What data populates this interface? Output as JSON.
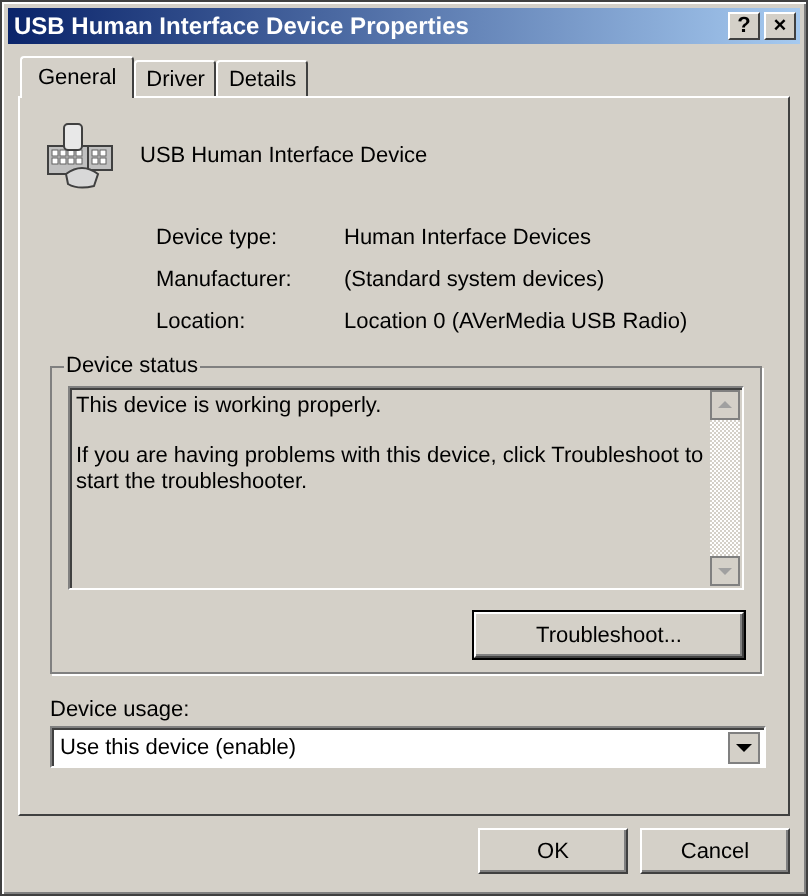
{
  "window": {
    "title": "USB Human Interface Device Properties",
    "help_button": "?",
    "close_button": "×"
  },
  "tabs": [
    {
      "label": "General",
      "selected": true
    },
    {
      "label": "Driver",
      "selected": false
    },
    {
      "label": "Details",
      "selected": false
    }
  ],
  "device": {
    "name": "USB Human Interface Device"
  },
  "properties": [
    {
      "label": "Device type:",
      "value": "Human Interface Devices"
    },
    {
      "label": "Manufacturer:",
      "value": "(Standard system devices)"
    },
    {
      "label": "Location:",
      "value": "Location 0 (AVerMedia USB Radio)"
    }
  ],
  "device_status": {
    "title": "Device status",
    "messages": [
      "This device is working properly.",
      "If you are having problems with this device, click Troubleshoot to start the troubleshooter."
    ]
  },
  "troubleshoot_button": "Troubleshoot...",
  "device_usage": {
    "label": "Device usage:",
    "value": "Use this device (enable)"
  },
  "buttons": [
    "OK",
    "Cancel"
  ]
}
